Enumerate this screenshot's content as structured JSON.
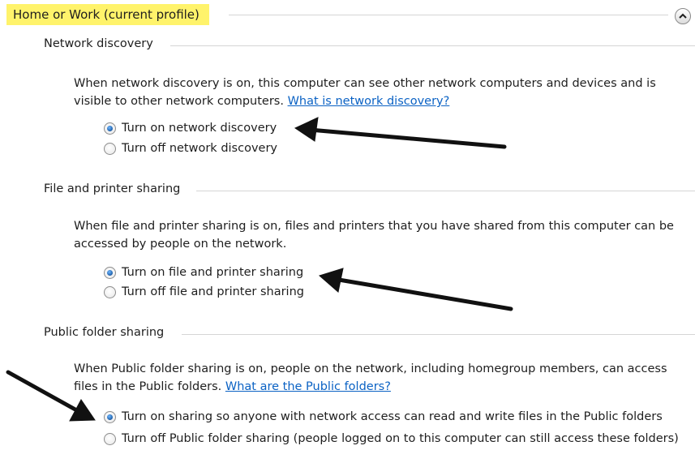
{
  "profile": {
    "title": "Home or Work (current profile)"
  },
  "sections": [
    {
      "title": "Network discovery",
      "description": "When network discovery is on, this computer can see other network computers and devices and is visible to other network computers.",
      "link": "What is network discovery?",
      "options": [
        {
          "label": "Turn on network discovery",
          "selected": true
        },
        {
          "label": "Turn off network discovery",
          "selected": false
        }
      ]
    },
    {
      "title": "File and printer sharing",
      "description": "When file and printer sharing is on, files and printers that you have shared from this computer can be accessed by people on the network.",
      "options": [
        {
          "label": "Turn on file and printer sharing",
          "selected": true
        },
        {
          "label": "Turn off file and printer sharing",
          "selected": false
        }
      ]
    },
    {
      "title": "Public folder sharing",
      "description": "When Public folder sharing is on, people on the network, including homegroup members, can access files in the Public folders.",
      "link": "What are the Public folders?",
      "options": [
        {
          "label": "Turn on sharing so anyone with network access can read and write files in the Public folders",
          "selected": true
        },
        {
          "label": "Turn off Public folder sharing (people logged on to this computer can still access these folders)",
          "selected": false
        }
      ]
    }
  ],
  "icons": {
    "collapse": "chevron-up-icon",
    "annotation": "arrow-annotation-icon"
  },
  "colors": {
    "highlight": "#fff36b",
    "link": "#0b62c4",
    "radio_selected": "#1f5fa8"
  }
}
